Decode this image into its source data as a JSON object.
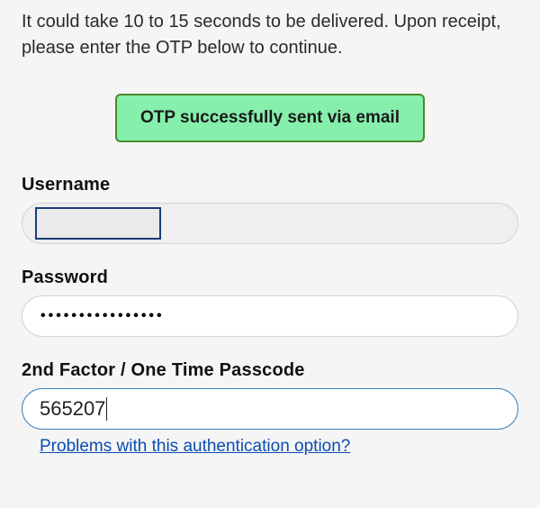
{
  "instructions": "It could take 10 to 15 seconds to be delivered. Upon receipt, please enter the OTP below to continue.",
  "alert": {
    "message": "OTP successfully sent via email"
  },
  "fields": {
    "username": {
      "label": "Username",
      "value": ""
    },
    "password": {
      "label": "Password",
      "masked_value": "••••••••••••••••"
    },
    "otp": {
      "label": "2nd Factor / One Time Passcode",
      "value": "565207"
    }
  },
  "help_link": {
    "text": "Problems with this authentication option?"
  }
}
